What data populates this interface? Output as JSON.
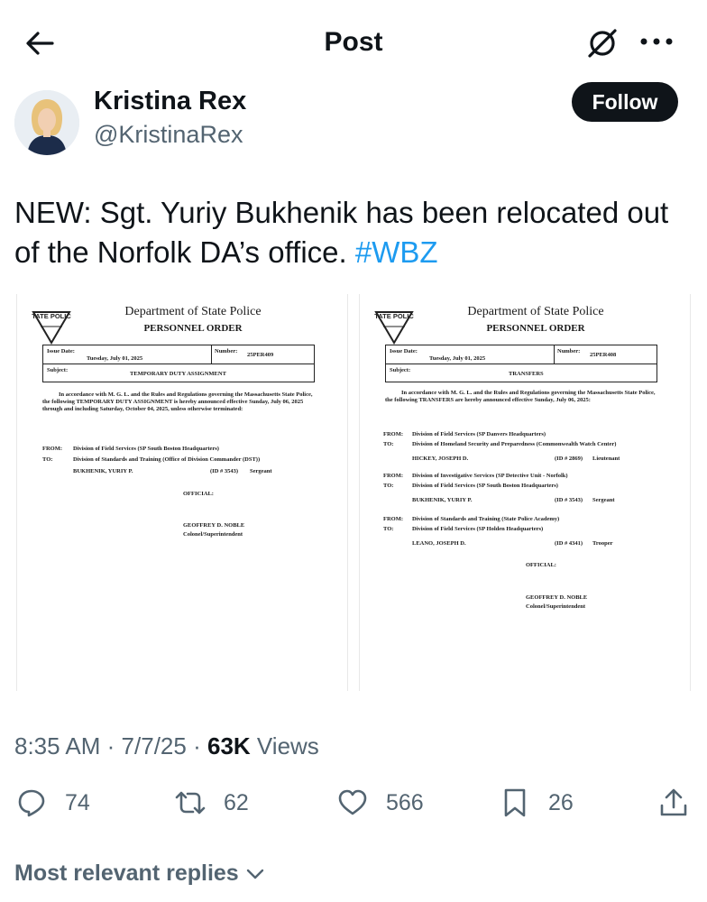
{
  "header": {
    "title": "Post"
  },
  "author": {
    "name": "Kristina Rex",
    "handle": "@KristinaRex",
    "follow_label": "Follow"
  },
  "tweet": {
    "text": "NEW: Sgt. Yuriy Bukhenik has been relocated out of the Norfolk DA’s office.",
    "hashtag": "#WBZ"
  },
  "documents": [
    {
      "seal_text": "STATE POLICE",
      "department": "Department of State Police",
      "order_title": "PERSONNEL ORDER",
      "issue_label": "Issue Date:",
      "issue_date": "Tuesday, July 01, 2025",
      "number_label": "Number:",
      "number": "25PER409",
      "subject_label": "Subject:",
      "subject": "TEMPORARY DUTY ASSIGNMENT",
      "intro": "In accordance with M. G. L. and the Rules and Regulations governing the Massachusetts State Police, the following TEMPORARY DUTY ASSIGNMENT is hereby announced effective Sunday, July 06, 2025 through and including Saturday, October 04, 2025, unless otherwise terminated:",
      "from_label": "FROM:",
      "from": "Division of Field Services (SP South Boston Headquarters)",
      "to_label": "TO:",
      "to": "Division of Standards and Training (Office of Division Commander (DST))",
      "person": "BUKHENIK, YURIY P.",
      "person_id": "(ID # 3543)",
      "person_rank": "Sergeant",
      "official": "OFFICIAL:",
      "signer": "GEOFFREY D. NOBLE",
      "signer_title": "Colonel/Superintendent"
    },
    {
      "seal_text": "STATE POLICE",
      "department": "Department of State Police",
      "order_title": "PERSONNEL ORDER",
      "issue_label": "Issue Date:",
      "issue_date": "Tuesday, July 01, 2025",
      "number_label": "Number:",
      "number": "25PER408",
      "subject_label": "Subject:",
      "subject": "TRANSFERS",
      "intro": "In accordance with M. G. L. and the Rules and Regulations governing the Massachusetts State Police, the following TRANSFERS are hereby announced effective Sunday, July 06, 2025:",
      "transfers": [
        {
          "from_label": "FROM:",
          "from": "Division of Field Services (SP Danvers Headquarters)",
          "to_label": "TO:",
          "to": "Division of Homeland Security and Preparedness (Commonwealth Watch Center)",
          "person": "HICKEY, JOSEPH D.",
          "person_id": "(ID # 2869)",
          "person_rank": "Lieutenant"
        },
        {
          "from_label": "FROM:",
          "from": "Division of Investigative Services (SP Detective Unit - Norfolk)",
          "to_label": "TO:",
          "to": "Division of Field Services (SP South Boston Headquarters)",
          "person": "BUKHENIK, YURIY P.",
          "person_id": "(ID # 3543)",
          "person_rank": "Sergeant"
        },
        {
          "from_label": "FROM:",
          "from": "Division of Standards and Training (State Police Academy)",
          "to_label": "TO:",
          "to": "Division of Field Services (SP Holden Headquarters)",
          "person": "LEANO, JOSEPH D.",
          "person_id": "(ID # 4341)",
          "person_rank": "Trooper"
        }
      ],
      "official": "OFFICIAL:",
      "signer": "GEOFFREY D. NOBLE",
      "signer_title": "Colonel/Superintendent"
    }
  ],
  "meta": {
    "time": "8:35 AM",
    "sep1": "·",
    "date": "7/7/25",
    "sep2": "·",
    "views_count": "63K",
    "views_label": "Views"
  },
  "actions": {
    "replies": "74",
    "reposts": "62",
    "likes": "566",
    "bookmarks": "26"
  },
  "footer": {
    "replies_sort": "Most relevant replies"
  },
  "colors": {
    "accent": "#1d9bf0",
    "text": "#0f1419",
    "muted": "#536471"
  },
  "icons": [
    "back-arrow-icon",
    "no-link-icon",
    "more-icon",
    "reply-icon",
    "repost-icon",
    "like-icon",
    "bookmark-icon",
    "share-icon",
    "chevron-down-icon"
  ]
}
